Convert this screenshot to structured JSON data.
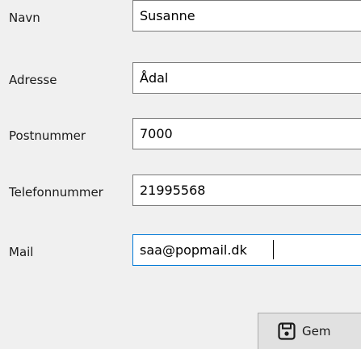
{
  "form": {
    "fields": [
      {
        "label": "Navn",
        "value": "Susanne"
      },
      {
        "label": "Adresse",
        "value": "Ådal"
      },
      {
        "label": "Postnummer",
        "value": "7000"
      },
      {
        "label": "Telefonnummer",
        "value": "21995568"
      },
      {
        "label": "Mail",
        "value": "saa@popmail.dk"
      }
    ],
    "focused_field": "Mail"
  },
  "actions": {
    "save_label": "Gem",
    "save_icon": "floppy-disk-icon"
  },
  "colors": {
    "background": "#f0f0f0",
    "input_border": "#7a7a7a",
    "focus_border": "#0078d7",
    "button_background": "#e1e1e1"
  }
}
